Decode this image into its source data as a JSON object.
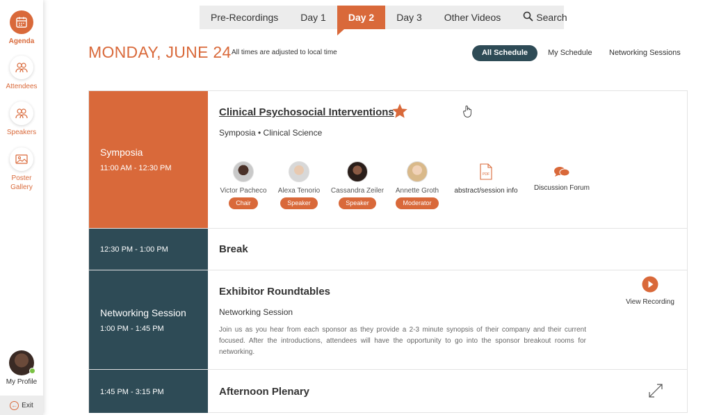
{
  "sidebar": {
    "items": [
      {
        "label": "Agenda",
        "icon": "calendar-icon"
      },
      {
        "label": "Attendees",
        "icon": "people-icon"
      },
      {
        "label": "Speakers",
        "icon": "speakers-icon"
      },
      {
        "label": "Poster Gallery",
        "icon": "image-icon"
      }
    ],
    "profile_label": "My Profile",
    "exit_label": "Exit"
  },
  "tabs": [
    "Pre-Recordings",
    "Day 1",
    "Day 2",
    "Day 3",
    "Other Videos",
    "Search"
  ],
  "active_tab": "Day 2",
  "header": {
    "date": "MONDAY, JUNE 24",
    "timezone_note": "All times are adjusted to local time"
  },
  "filters": {
    "all": "All Schedule",
    "mine": "My Schedule",
    "networking": "Networking Sessions"
  },
  "sessions": [
    {
      "type": "Symposia",
      "time": "11:00 AM - 12:30 PM",
      "title": "Clinical Psychosocial Interventions",
      "subtitle": "Symposia  •  Clinical Science",
      "people": [
        {
          "name": "Victor Pacheco",
          "role": "Chair"
        },
        {
          "name": "Alexa Tenorio",
          "role": "Speaker"
        },
        {
          "name": "Cassandra Zeiler",
          "role": "Speaker"
        },
        {
          "name": "Annette Groth",
          "role": "Moderator"
        }
      ],
      "links": [
        {
          "label": "abstract/session info",
          "icon": "pdf-icon",
          "icon_text": "PDF"
        },
        {
          "label": "Discussion Forum",
          "icon": "chat-bubbles-icon"
        }
      ]
    },
    {
      "type": "",
      "time": "12:30 PM - 1:00 PM",
      "title": "Break"
    },
    {
      "type": "Networking Session",
      "time": "1:00 PM - 1:45 PM",
      "title": "Exhibitor Roundtables",
      "subtitle": "Networking Session",
      "description": "Join us as you hear from each sponsor as they provide a 2-3 minute synopsis of their company and their current focused. After the introductions, attendees will have the opportunity to go into the sponsor breakout rooms for networking.",
      "action": "View Recording"
    },
    {
      "type": "",
      "time": "1:45 PM - 3:15 PM",
      "title": "Afternoon Plenary"
    }
  ],
  "colors": {
    "accent": "#d9693a",
    "teal": "#2e4b56",
    "online": "#7ac143"
  }
}
